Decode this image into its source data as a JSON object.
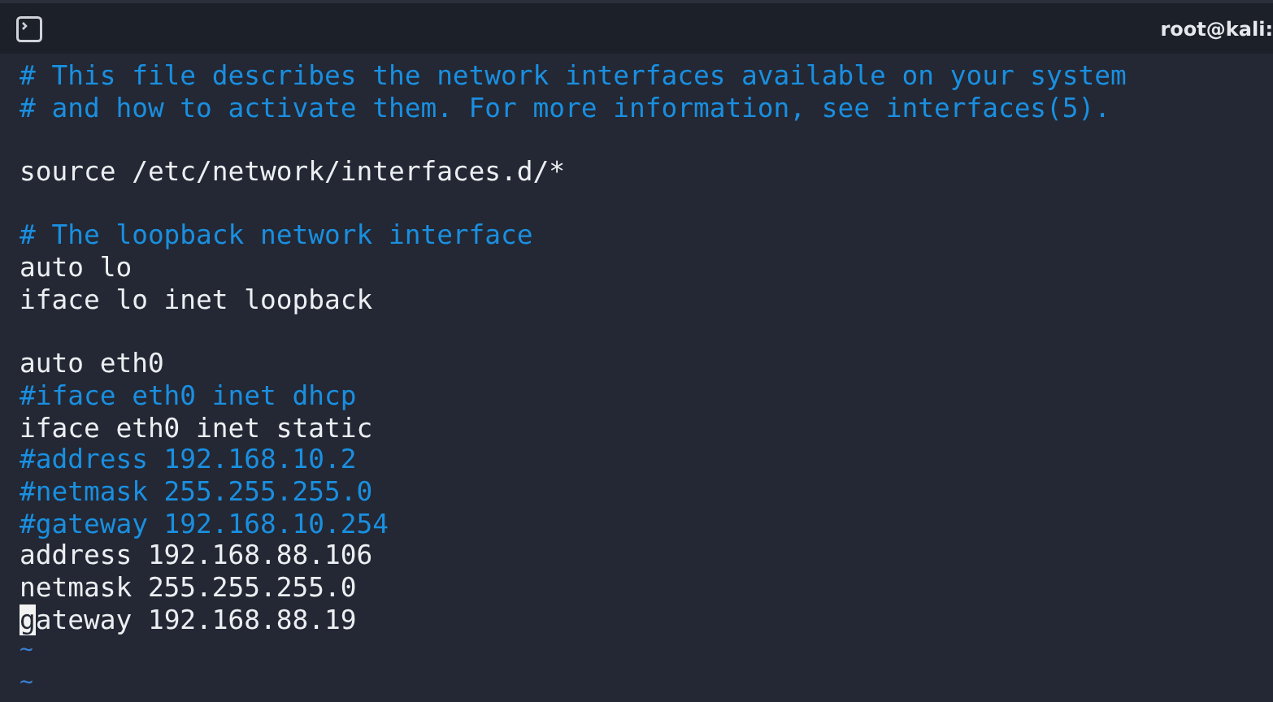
{
  "window": {
    "title": "root@kali:"
  },
  "lines": [
    {
      "kind": "comment",
      "text": "# This file describes the network interfaces available on your system"
    },
    {
      "kind": "comment",
      "text": "# and how to activate them. For more information, see interfaces(5)."
    },
    {
      "kind": "blank"
    },
    {
      "kind": "code",
      "text": "source /etc/network/interfaces.d/*",
      "cursor": false
    },
    {
      "kind": "blank"
    },
    {
      "kind": "comment",
      "text": "# The loopback network interface"
    },
    {
      "kind": "code",
      "text": "auto lo",
      "cursor": false
    },
    {
      "kind": "code",
      "text": "iface lo inet loopback",
      "cursor": false
    },
    {
      "kind": "blank"
    },
    {
      "kind": "code",
      "text": "auto eth0",
      "cursor": false
    },
    {
      "kind": "comment",
      "text": "#iface eth0 inet dhcp"
    },
    {
      "kind": "code",
      "text": "iface eth0 inet static",
      "cursor": false
    },
    {
      "kind": "comment",
      "text": "#address 192.168.10.2"
    },
    {
      "kind": "comment",
      "text": "#netmask 255.255.255.0"
    },
    {
      "kind": "comment",
      "text": "#gateway 192.168.10.254"
    },
    {
      "kind": "code",
      "text": "address 192.168.88.106",
      "cursor": false
    },
    {
      "kind": "code",
      "text": "netmask 255.255.255.0",
      "cursor": false
    },
    {
      "kind": "code",
      "text": "gateway 192.168.88.19",
      "cursor": true
    },
    {
      "kind": "tilde",
      "text": "~"
    },
    {
      "kind": "tilde",
      "text": "~"
    }
  ]
}
